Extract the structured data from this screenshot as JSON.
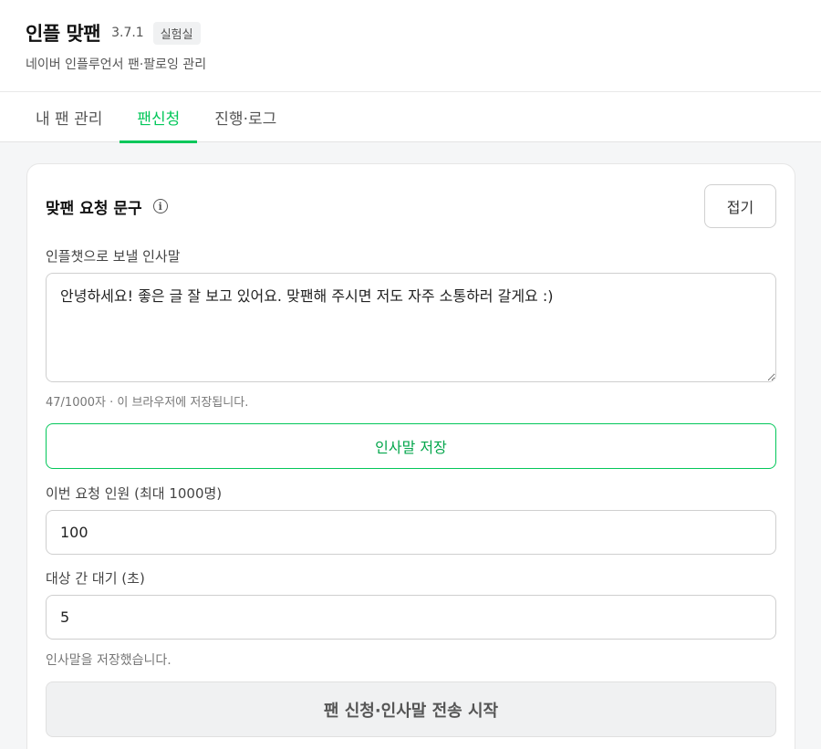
{
  "header": {
    "title": "인플 맞팬",
    "version": "3.7.1",
    "badge": "실험실",
    "subtitle": "네이버 인플루언서 팬·팔로잉 관리"
  },
  "tabs": [
    {
      "label": "내 팬 관리",
      "active": false
    },
    {
      "label": "팬신청",
      "active": true
    },
    {
      "label": "진행·로그",
      "active": false
    }
  ],
  "card": {
    "title": "맞팬 요청 문구",
    "info_icon": "info-icon",
    "fold_label": "접기",
    "greeting_label": "인플챗으로 보낼 인사말",
    "greeting_value": "안녕하세요! 좋은 글 잘 보고 있어요. 맞팬해 주시면 저도 자주 소통하러 갈게요 :)",
    "greeting_helper": "47/1000자 · 이 브라우저에 저장됩니다.",
    "save_label": "인사말 저장",
    "count_label": "이번 요청 인원 (최대 1000명)",
    "count_value": "100",
    "delay_label": "대상 간 대기 (초)",
    "delay_value": "5",
    "status_text": "인사말을 저장했습니다.",
    "start_label": "팬 신청·인사말 전송 시작"
  },
  "colors": {
    "accent": "#03c75a",
    "background": "#f5f6f7"
  }
}
